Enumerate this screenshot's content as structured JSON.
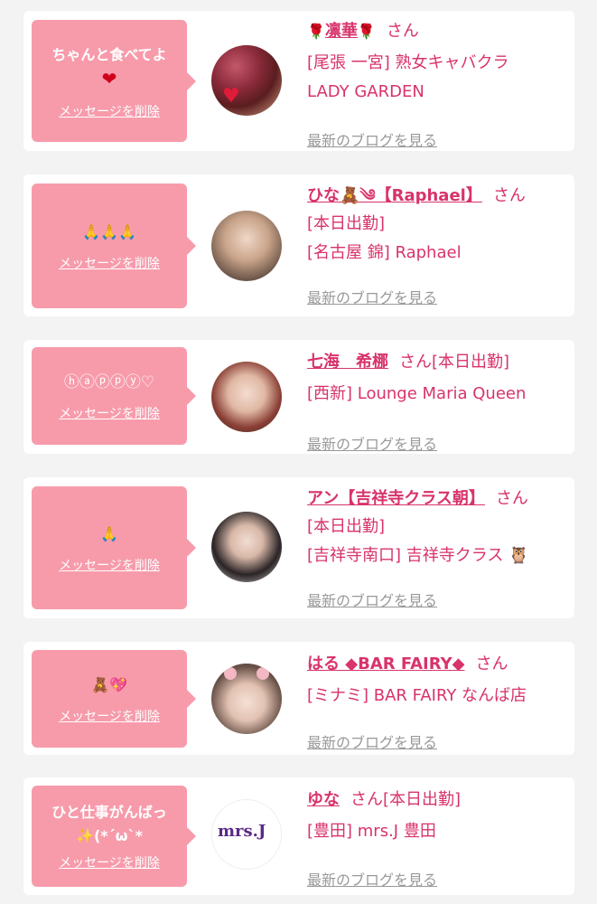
{
  "colors": {
    "bubble": "#f79bab",
    "accent": "#d8336b",
    "muted": "#999999"
  },
  "delete_label": "メッセージを削除",
  "blog_label": "最新のブログを見る",
  "entries": [
    {
      "message": "ちゃんと食べてよ",
      "message_icon": "heart-icon",
      "name": "凛華",
      "name_icon": "rose-icon",
      "san": "さん",
      "lines": [
        "[尾張 一宮] 熟女キャバクラ",
        "LADY GARDEN"
      ]
    },
    {
      "message": "🙏🙏🙏",
      "name": "ひな🧸༄【Raphael】",
      "san": "さん",
      "lines": [
        "[本日出勤]",
        "[名古屋 錦] Raphael"
      ]
    },
    {
      "message": "ⓗⓐⓟⓟⓨ♡",
      "name": "七海　希梛",
      "san": "さん[本日出勤]",
      "lines": [
        "[西新] Lounge Maria Queen"
      ]
    },
    {
      "message": "🙏",
      "name": "アン【吉祥寺クラス朝】",
      "san": "さん",
      "lines": [
        "[本日出勤]",
        "[吉祥寺南口] 吉祥寺クラス 🦉"
      ]
    },
    {
      "message": "🧸💖",
      "name": "はる ◆BAR FAIRY◆",
      "san": "さん",
      "lines": [
        "[ミナミ] BAR FAIRY なんば店"
      ]
    },
    {
      "message": "ひと仕事がんばっ\n✨(*´ω`*",
      "name": "ゆな",
      "san": "さん[本日出勤]",
      "lines": [
        "[豊田] mrs.J 豊田"
      ],
      "avatar_logo": "mrs.J"
    }
  ]
}
